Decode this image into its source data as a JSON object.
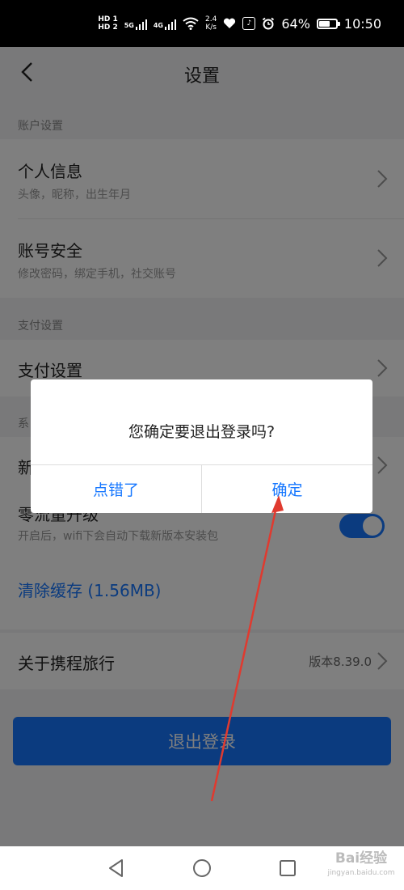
{
  "status_bar": {
    "hd1": "HD 1",
    "hd2": "HD 2",
    "net1": "5G",
    "net2": "4G",
    "speed_value": "2.4",
    "speed_unit": "K/s",
    "battery_percent": "64%",
    "battery_level": 0.64,
    "time": "10:50"
  },
  "header": {
    "title": "设置"
  },
  "sections": {
    "account": {
      "label": "账户设置",
      "items": [
        {
          "title": "个人信息",
          "subtitle": "头像，昵称，出生年月"
        },
        {
          "title": "账号安全",
          "subtitle": "修改密码，绑定手机，社交账号"
        }
      ]
    },
    "payment": {
      "label": "支付设置",
      "items": [
        {
          "title": "支付设置"
        }
      ]
    },
    "system": {
      "label": "系",
      "new_item_prefix": "新",
      "zero_flow": {
        "title": "零流量升级",
        "subtitle": "开启后，wifi下会自动下载新版本安装包",
        "enabled": true
      },
      "clear_cache": "清除缓存 (1.56MB)"
    },
    "about": {
      "title": "关于携程旅行",
      "version": "版本8.39.0"
    }
  },
  "logout_button": "退出登录",
  "dialog": {
    "message": "您确定要退出登录吗?",
    "cancel": "点错了",
    "confirm": "确定"
  },
  "colors": {
    "accent": "#1677ff",
    "annotation_arrow": "#e03a2f"
  },
  "watermark": {
    "brand": "Bai经验",
    "url": "jingyan.baidu.com"
  }
}
